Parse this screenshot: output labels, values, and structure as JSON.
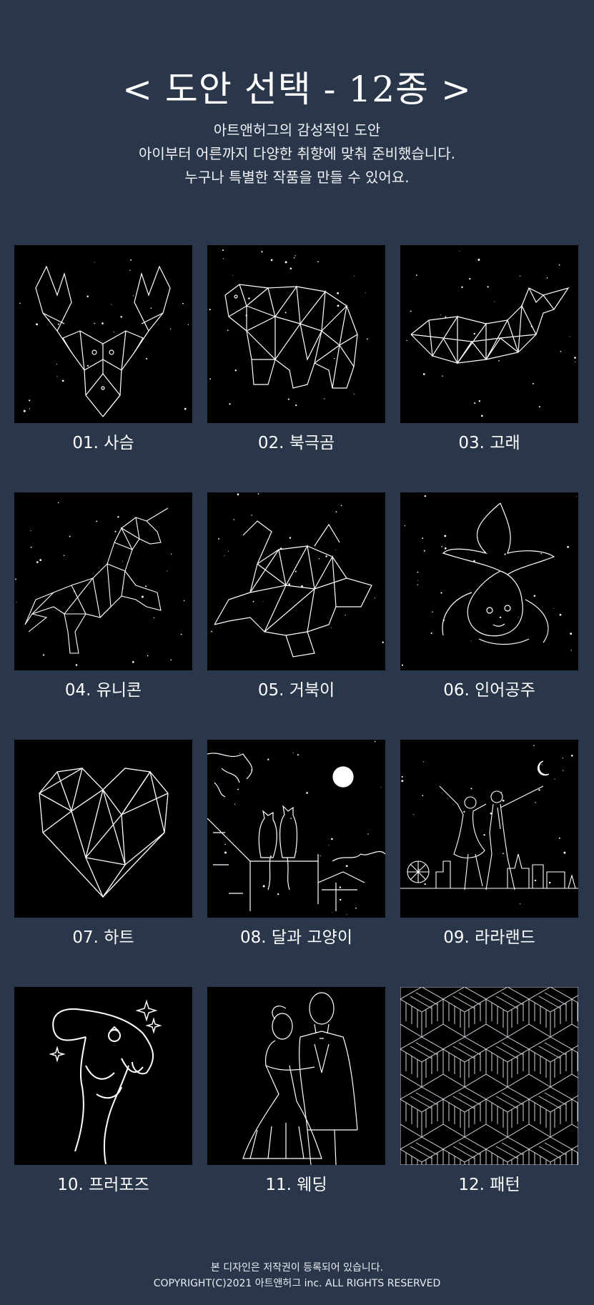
{
  "header": {
    "title": "< 도안 선택 - 12종 >",
    "description": [
      "아트앤허그의 감성적인 도안",
      "아이부터 어른까지 다양한 취향에 맞춰 준비했습니다.",
      "누구나 특별한 작품을 만들 수 있어요."
    ]
  },
  "designs": [
    {
      "label": "01. 사슴",
      "icon": "deer-constellation-icon"
    },
    {
      "label": "02. 북극곰",
      "icon": "polar-bear-constellation-icon"
    },
    {
      "label": "03. 고래",
      "icon": "whale-constellation-icon"
    },
    {
      "label": "04. 유니콘",
      "icon": "unicorn-constellation-icon"
    },
    {
      "label": "05. 거북이",
      "icon": "turtle-constellation-icon"
    },
    {
      "label": "06. 인어공주",
      "icon": "mermaid-line-art-icon"
    },
    {
      "label": "07. 하트",
      "icon": "heart-constellation-icon"
    },
    {
      "label": "08. 달과 고양이",
      "icon": "moon-and-cats-icon"
    },
    {
      "label": "09. 라라랜드",
      "icon": "dancing-couple-city-icon"
    },
    {
      "label": "10. 프러포즈",
      "icon": "proposal-ring-hand-icon"
    },
    {
      "label": "11. 웨딩",
      "icon": "wedding-couple-icon"
    },
    {
      "label": "12. 패턴",
      "icon": "cube-pattern-icon"
    }
  ],
  "footer": {
    "line1": "본 디자인은 저작권이 등록되어 있습니다.",
    "line2": "COPYRIGHT(C)2021 아트앤허그 inc. ALL RIGHTS RESERVED"
  },
  "colors": {
    "background": "#2a3649",
    "thumbnail": "#000000",
    "text": "#ffffff"
  }
}
